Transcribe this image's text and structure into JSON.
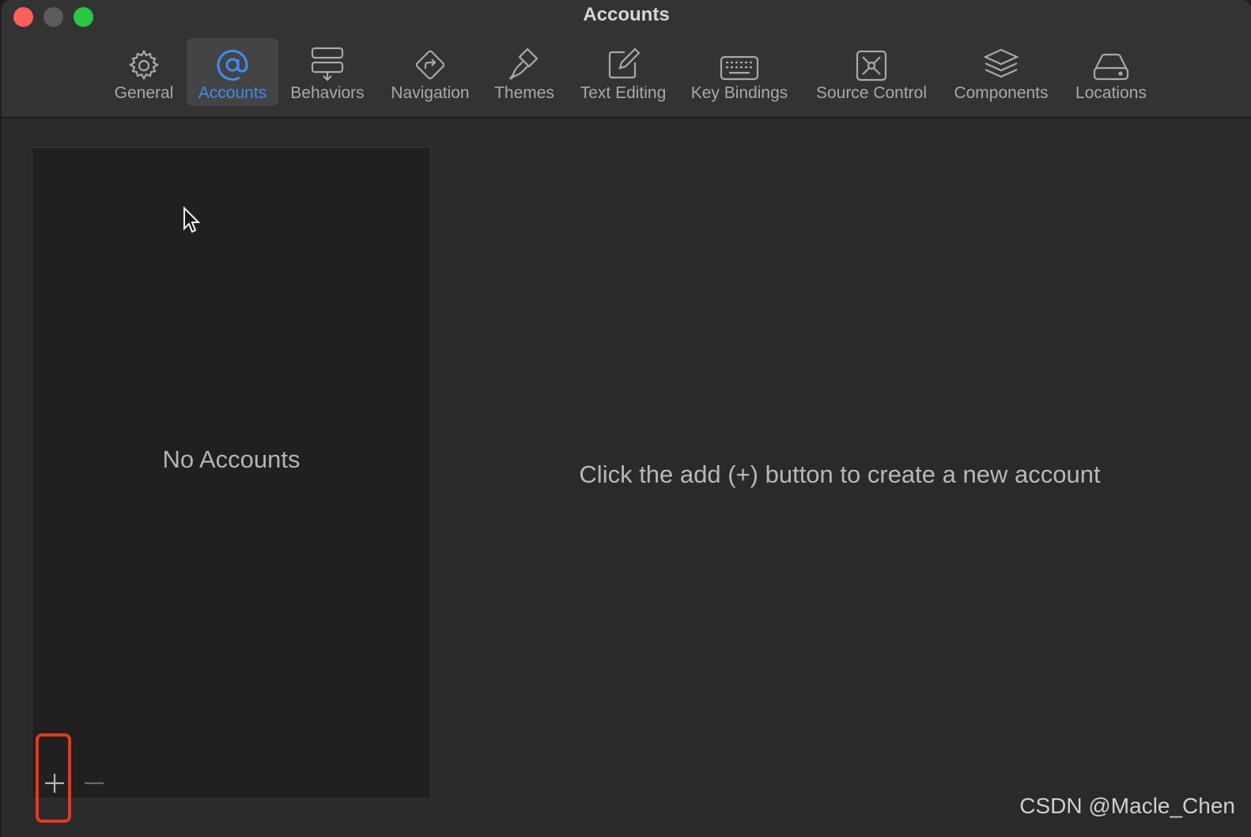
{
  "window": {
    "title": "Accounts",
    "traffic_lights": [
      "close",
      "minimize",
      "maximize"
    ]
  },
  "tabs": [
    {
      "label": "General",
      "icon": "gear-icon"
    },
    {
      "label": "Accounts",
      "icon": "at-sign-icon",
      "active": true
    },
    {
      "label": "Behaviors",
      "icon": "behaviors-icon"
    },
    {
      "label": "Navigation",
      "icon": "navigation-icon"
    },
    {
      "label": "Themes",
      "icon": "brush-icon"
    },
    {
      "label": "Text Editing",
      "icon": "edit-icon"
    },
    {
      "label": "Key Bindings",
      "icon": "keyboard-icon"
    },
    {
      "label": "Source Control",
      "icon": "source-control-icon"
    },
    {
      "label": "Components",
      "icon": "layers-icon"
    },
    {
      "label": "Locations",
      "icon": "drive-icon"
    }
  ],
  "accounts_list": {
    "empty_text": "No Accounts",
    "add_label": "+",
    "remove_label": "—"
  },
  "detail": {
    "hint": "Click the add (+) button to create a new account"
  },
  "watermark": "CSDN @Macle_Chen",
  "colors": {
    "accent": "#3f8cf0",
    "highlight": "#e6391f",
    "close": "#fe5f57",
    "maximize": "#28c840"
  }
}
